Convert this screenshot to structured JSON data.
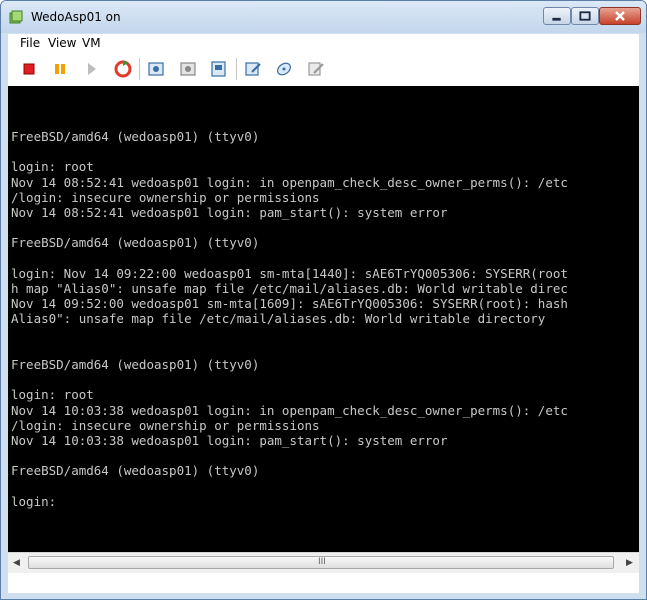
{
  "window": {
    "title": "WedoAsp01 on"
  },
  "menu": {
    "file": "File",
    "view": "View",
    "vm": "VM"
  },
  "toolbar": {
    "icons": [
      "stop-icon",
      "pause-icon",
      "play-icon",
      "reset-icon",
      "snapshot-icon",
      "revert-snapshot-icon",
      "manage-snapshots-icon",
      "settings-icon",
      "connect-device-icon",
      "edit-icon"
    ]
  },
  "console": {
    "lines": [
      "FreeBSD/amd64 (wedoasp01) (ttyv0)",
      "",
      "login: root",
      "Nov 14 08:52:41 wedoasp01 login: in openpam_check_desc_owner_perms(): /etc",
      "/login: insecure ownership or permissions",
      "Nov 14 08:52:41 wedoasp01 login: pam_start(): system error",
      "",
      "FreeBSD/amd64 (wedoasp01) (ttyv0)",
      "",
      "login: Nov 14 09:22:00 wedoasp01 sm-mta[1440]: sAE6TrYQ005306: SYSERR(root",
      "h map \"Alias0\": unsafe map file /etc/mail/aliases.db: World writable direc",
      "Nov 14 09:52:00 wedoasp01 sm-mta[1609]: sAE6TrYQ005306: SYSERR(root): hash",
      "Alias0\": unsafe map file /etc/mail/aliases.db: World writable directory",
      "",
      "",
      "FreeBSD/amd64 (wedoasp01) (ttyv0)",
      "",
      "login: root",
      "Nov 14 10:03:38 wedoasp01 login: in openpam_check_desc_owner_perms(): /etc",
      "/login: insecure ownership or permissions",
      "Nov 14 10:03:38 wedoasp01 login: pam_start(): system error",
      "",
      "FreeBSD/amd64 (wedoasp01) (ttyv0)",
      "",
      "login: "
    ]
  },
  "scrollbar": {
    "grip": "III"
  },
  "colors": {
    "console_bg": "#000000",
    "console_text": "#c8c8c8",
    "stop": "#e02020",
    "pause": "#f5a000",
    "reset": "#e03a2a"
  }
}
